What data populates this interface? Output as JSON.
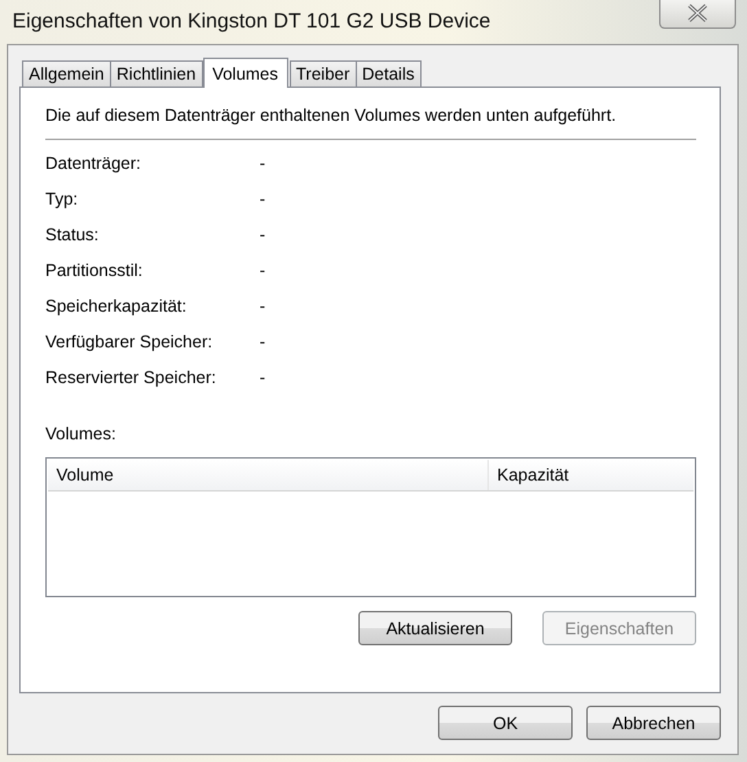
{
  "window": {
    "title": "Eigenschaften von Kingston DT 101 G2 USB Device"
  },
  "tabs": [
    {
      "label": "Allgemein",
      "selected": false
    },
    {
      "label": "Richtlinien",
      "selected": false
    },
    {
      "label": "Volumes",
      "selected": true
    },
    {
      "label": "Treiber",
      "selected": false
    },
    {
      "label": "Details",
      "selected": false
    }
  ],
  "intro": "Die auf diesem Datenträger enthaltenen Volumes werden unten aufgeführt.",
  "properties": [
    {
      "label": "Datenträger:",
      "value": "-"
    },
    {
      "label": "Typ:",
      "value": "-"
    },
    {
      "label": "Status:",
      "value": "-"
    },
    {
      "label": "Partitionsstil:",
      "value": "-"
    },
    {
      "label": "Speicherkapazität:",
      "value": "-"
    },
    {
      "label": "Verfügbarer Speicher:",
      "value": "-"
    },
    {
      "label": "Reservierter Speicher:",
      "value": "-"
    }
  ],
  "volumes": {
    "label": "Volumes:",
    "columns": [
      "Volume",
      "Kapazität"
    ]
  },
  "panel_buttons": [
    {
      "label": "Aktualisieren",
      "disabled": false
    },
    {
      "label": "Eigenschaften",
      "disabled": true
    }
  ],
  "buttons": [
    {
      "label": "OK",
      "disabled": false
    },
    {
      "label": "Abbrechen",
      "disabled": false
    }
  ]
}
